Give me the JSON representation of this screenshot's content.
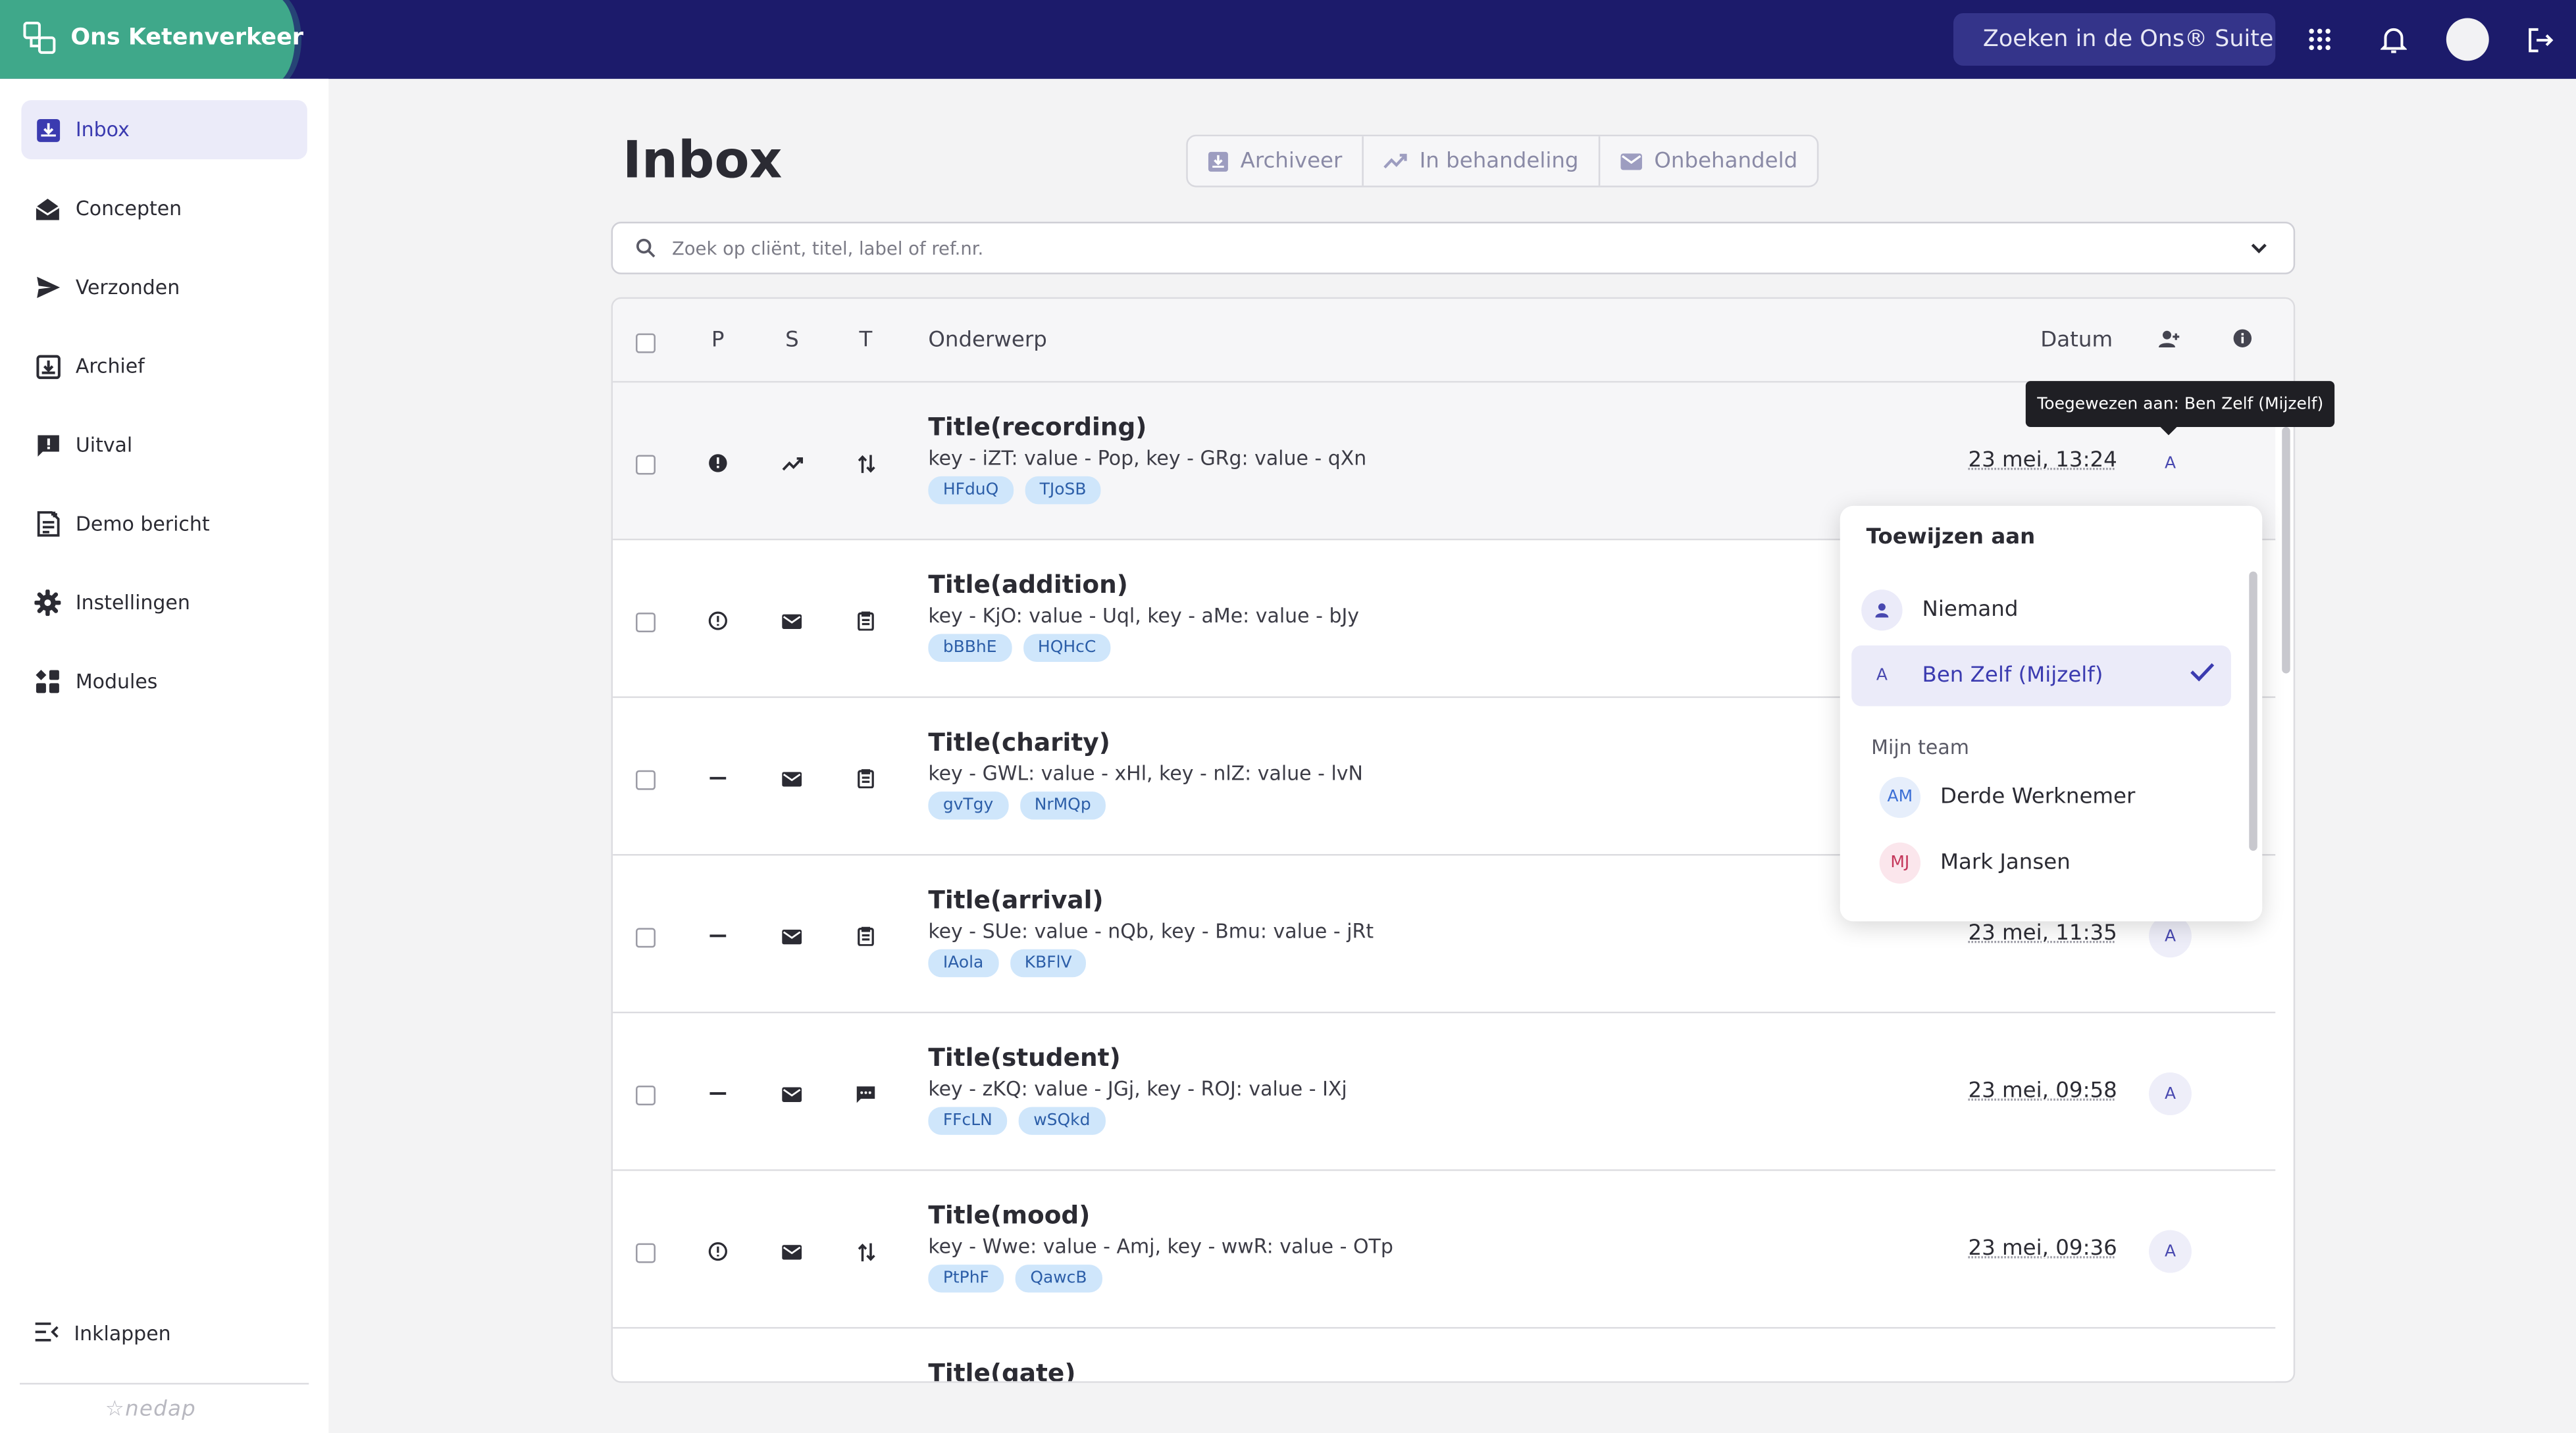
{
  "app": {
    "name": "Ons Ketenverkeer"
  },
  "topbar": {
    "search_placeholder": "Zoeken in de Ons® Suite...",
    "icons": [
      "apps-grid-icon",
      "bell-icon",
      "avatar",
      "logout-icon"
    ]
  },
  "sidebar": {
    "items": [
      {
        "label": "Inbox",
        "icon": "inbox-icon",
        "active": true
      },
      {
        "label": "Concepten",
        "icon": "envelope-open-icon"
      },
      {
        "label": "Verzonden",
        "icon": "send-icon"
      },
      {
        "label": "Archief",
        "icon": "archive-icon"
      },
      {
        "label": "Uitval",
        "icon": "alert-message-icon"
      },
      {
        "label": "Demo bericht",
        "icon": "document-plus-icon"
      },
      {
        "label": "Instellingen",
        "icon": "gear-icon"
      },
      {
        "label": "Modules",
        "icon": "modules-icon"
      }
    ],
    "collapse_label": "Inklappen",
    "footer_logo": "nedap"
  },
  "page": {
    "title": "Inbox",
    "actions": [
      {
        "label": "Archiveer",
        "icon": "archive-icon"
      },
      {
        "label": "In behandeling",
        "icon": "trend-icon"
      },
      {
        "label": "Onbehandeld",
        "icon": "envelope-icon"
      }
    ],
    "search_placeholder": "Zoek op cliënt, titel, label of ref.nr."
  },
  "table": {
    "headers": {
      "p": "P",
      "s": "S",
      "t": "T",
      "subject": "Onderwerp",
      "date": "Datum"
    },
    "rows": [
      {
        "title": "Title(recording)",
        "desc": "key - iZT: value - Pop, key - GRg: value - qXn",
        "tags": [
          "HFduQ",
          "TJoSB"
        ],
        "date": "23 mei, 13:24",
        "assignee": "A",
        "p": "alert",
        "s": "trend",
        "t": "transfer"
      },
      {
        "title": "Title(addition)",
        "desc": "key - KjO: value - Uql, key - aMe: value - bJy",
        "tags": [
          "bBBhE",
          "HQHcC"
        ],
        "date": "",
        "assignee": "",
        "p": "info-outline",
        "s": "envelope",
        "t": "clipboard"
      },
      {
        "title": "Title(charity)",
        "desc": "key - GWL: value - xHl, key - nlZ: value - lvN",
        "tags": [
          "gvTgy",
          "NrMQp"
        ],
        "date": "",
        "assignee": "",
        "p": "dash",
        "s": "envelope",
        "t": "clipboard"
      },
      {
        "title": "Title(arrival)",
        "desc": "key - SUe: value - nQb, key - Bmu: value - jRt",
        "tags": [
          "IAola",
          "KBFlV"
        ],
        "date": "23 mei, 11:35",
        "assignee": "A",
        "p": "dash",
        "s": "envelope",
        "t": "clipboard"
      },
      {
        "title": "Title(student)",
        "desc": "key - zKQ: value - JGj, key - ROJ: value - IXj",
        "tags": [
          "FFcLN",
          "wSQkd"
        ],
        "date": "23 mei, 09:58",
        "assignee": "A",
        "p": "dash",
        "s": "envelope",
        "t": "chat"
      },
      {
        "title": "Title(mood)",
        "desc": "key - Wwe: value - Amj, key - wwR: value - OTp",
        "tags": [
          "PtPhF",
          "QawcB"
        ],
        "date": "23 mei, 09:36",
        "assignee": "A",
        "p": "info-outline",
        "s": "envelope",
        "t": "transfer"
      },
      {
        "title": "Title(gate)",
        "desc": "",
        "tags": [],
        "date": "",
        "assignee": ""
      }
    ]
  },
  "tooltip": {
    "text": "Toegewezen aan: Ben Zelf (Mijzelf)"
  },
  "assign_dropdown": {
    "title": "Toewijzen aan",
    "options": [
      {
        "initials": "",
        "name": "Niemand",
        "icon": "person-icon"
      },
      {
        "initials": "A",
        "name": "Ben Zelf (Mijzelf)",
        "selected": true
      }
    ],
    "team_label": "Mijn team",
    "team": [
      {
        "initials": "AM",
        "name": "Derde Werknemer",
        "color": "#3b6fd6",
        "bg": "#e6eefb"
      },
      {
        "initials": "MJ",
        "name": "Mark Jansen",
        "color": "#c4365a",
        "bg": "#fbe6ec"
      }
    ]
  },
  "colors": {
    "topbar": "#1c1b6b",
    "brand": "#3fa88a",
    "accent": "#3b3bb0",
    "tag_bg": "#cfe6fb"
  }
}
